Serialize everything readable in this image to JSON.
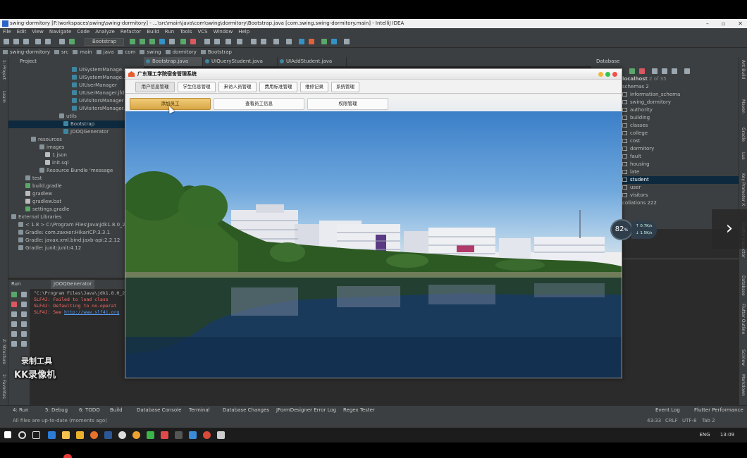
{
  "ide": {
    "title": "swing-dormitory [F:\\workspaces\\swing\\swing-dormitory] - ...\\src\\main\\java\\com\\swing\\dormitory\\Bootstrap.java [com.swing.swing-dormitory.main] - IntelliJ IDEA",
    "menu": [
      "File",
      "Edit",
      "View",
      "Navigate",
      "Code",
      "Analyze",
      "Refactor",
      "Build",
      "Run",
      "Tools",
      "VCS",
      "Window",
      "Help"
    ],
    "run_config": "Bootstrap",
    "breadcrumb": [
      "swing-dormitory",
      "src",
      "main",
      "java",
      "com",
      "swing",
      "dormitory",
      "Bootstrap"
    ],
    "project_header": "Project",
    "project_tree": [
      "UISystemManage...",
      "UISystemManage...",
      "UIUserManager",
      "UIUserManager.jfd",
      "UIVisitorsManager",
      "UIVisitorsManager.j",
      "utils",
      "Bootstrap",
      "JOOQGenerator",
      "resources",
      "images",
      "1.json",
      "init.sql",
      "Resource Bundle 'message",
      "test",
      "build.gradle",
      "gradlew",
      "gradlew.bat",
      "settings.gradle",
      "External Libraries",
      "< 1.8 > C:\\Program Files\\Java\\jdk1.8.0_20",
      "Gradle: com.zaxxer:HikariCP:3.3.1",
      "Gradle: javax.xml.bind:jaxb-api:2.2.12",
      "Gradle: junit:junit:4.12"
    ],
    "editor_tabs": [
      "Bootstrap.java",
      "UIQueryStudent.java",
      "UIAddStudent.java"
    ],
    "database": {
      "header": "Database",
      "host": "localhost",
      "host_count": "2 of 35",
      "schemas": "schemas 2",
      "information_schema": "information_schema",
      "swing_dormitory": "swing_dormitory",
      "tables": [
        "authority",
        "building",
        "classes",
        "college",
        "cost",
        "dormitory",
        "fault",
        "housing",
        "late",
        "student",
        "user",
        "visitors"
      ],
      "selected_table": "student",
      "collations": "collations 222"
    },
    "run": {
      "tab_label": "Run",
      "tab_config": "JOOQGenerator",
      "console": [
        "\"C:\\Program Files\\Java\\jdk1.8.0_20\"",
        "SLF4J: Failed to load class",
        "SLF4J: Defaulting to no-operat",
        "SLF4J: See ",
        "http://www.slf4j.org"
      ]
    },
    "bottom_tools": [
      "4: Run",
      "5: Debug",
      "6: TODO",
      "Build",
      "Database Console",
      "Terminal",
      "Database Changes",
      "JFormDesigner Error Log",
      "Regex Tester",
      "Event Log",
      "Flutter Performance"
    ],
    "status_message": "All files are up-to-date (moments ago)",
    "status_right": [
      "43:33",
      "CRLF",
      "UTF-8",
      "Tab 2"
    ],
    "left_strip_labels": [
      "1: Project",
      "Learn",
      "Z: Structure",
      "2: Favorites"
    ],
    "right_strip_labels": [
      "Ant Build",
      "Maven",
      "Gradle",
      "Lua",
      "Key Promoter X",
      "Flutter Inspector",
      "Database",
      "Flutter Outline",
      "SciView",
      "Markdown"
    ]
  },
  "app": {
    "title": "广东理工学院宿舍管理系统",
    "tabs": [
      "用户信息管理",
      "学生信息管理",
      "来访人员管理",
      "费用标准管理",
      "维修记录",
      "系统管理"
    ],
    "active_tab": "用户信息管理",
    "buttons": [
      "添加员工",
      "查看员工信息",
      "权限管理"
    ]
  },
  "overlay": {
    "speed": "82",
    "speed_unit": "%",
    "net_up": "0.7",
    "net_up_unit": "K/s",
    "net_down": "1.5",
    "net_down_unit": "K/s",
    "next_glyph": "›"
  },
  "watermark": {
    "line1": "录制工具",
    "line2": "KK录像机"
  },
  "taskbar": {
    "lang": "ENG",
    "time": "13:09"
  },
  "colors": {
    "ide_bg": "#2b2b2b",
    "ide_panel": "#3c3f41",
    "selection": "#0d293e",
    "primary_button": "#e0b256",
    "sky": "#5a9ad8",
    "water": "#1a3a5c"
  }
}
